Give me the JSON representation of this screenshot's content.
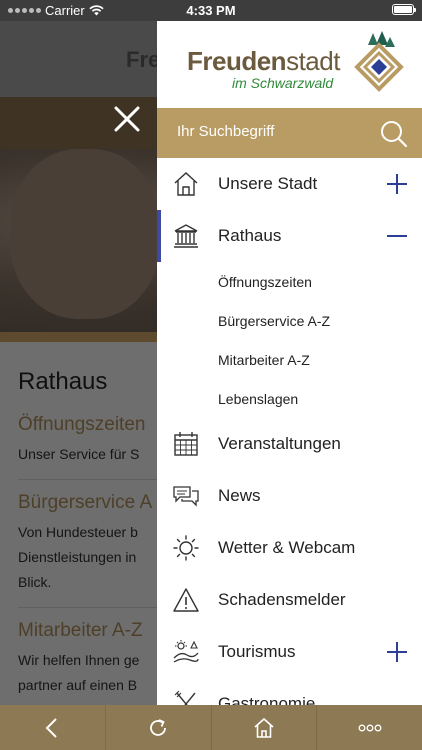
{
  "status_bar": {
    "carrier": "Carrier",
    "time": "4:33 PM"
  },
  "background_page": {
    "brand_partial": "Fre",
    "section_title": "Rathaus",
    "entries": [
      {
        "title": "Öffnungszeiten",
        "lines": [
          "Unser Service für S"
        ]
      },
      {
        "title": "Bürgerservice A",
        "lines": [
          "Von Hundesteuer b",
          "Dienstleistungen in",
          "Blick."
        ]
      },
      {
        "title": "Mitarbeiter A-Z",
        "lines": [
          "Wir helfen Ihnen ge",
          "partner auf einen B"
        ]
      }
    ]
  },
  "logo": {
    "title_bold": "Freuden",
    "title_light": "stadt",
    "subtitle": "im Schwarzwald"
  },
  "search": {
    "placeholder": "Ihr Suchbegriff"
  },
  "menu": {
    "items": [
      {
        "label": "Unsere Stadt",
        "icon": "home-icon",
        "toggle": "+"
      },
      {
        "label": "Rathaus",
        "icon": "townhall-icon",
        "toggle": "−"
      },
      {
        "label": "Öffnungszeiten"
      },
      {
        "label": "Bürgerservice A-Z"
      },
      {
        "label": "Mitarbeiter A-Z"
      },
      {
        "label": "Lebenslagen"
      },
      {
        "label": "Veranstaltungen",
        "icon": "calendar-icon"
      },
      {
        "label": "News",
        "icon": "chat-bubbles-icon"
      },
      {
        "label": "Wetter & Webcam",
        "icon": "sun-icon"
      },
      {
        "label": "Schadensmelder",
        "icon": "warning-icon"
      },
      {
        "label": "Tourismus",
        "icon": "landscape-icon",
        "toggle": "+"
      },
      {
        "label": "Gastronomie",
        "icon": "cutlery-icon"
      }
    ]
  },
  "colors": {
    "accent_gold": "#b99b64",
    "active_indicator": "#3f4aa3",
    "bottom_bar": "#8d7953"
  },
  "bottom_bar": {
    "buttons": [
      "back-icon",
      "reload-icon",
      "home-icon",
      "more-icon"
    ]
  }
}
